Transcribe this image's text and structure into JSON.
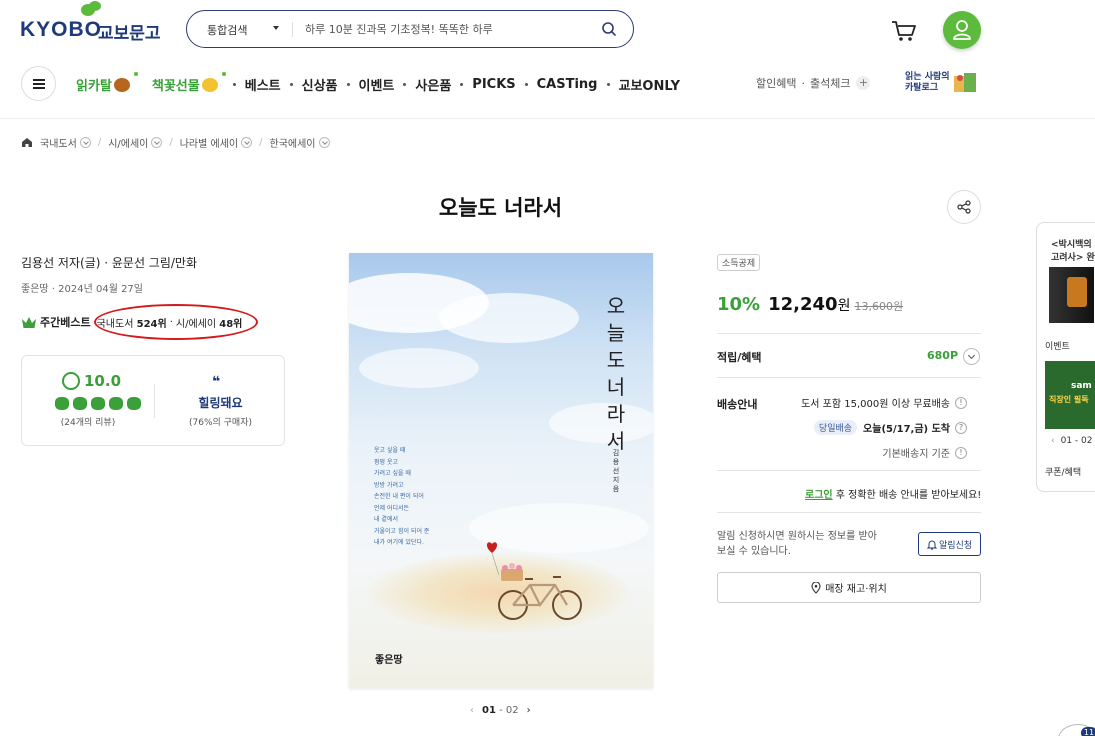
{
  "header": {
    "logo_en": "KYOBO",
    "logo_ko": "교보문고",
    "search_scope": "통합검색",
    "search_placeholder": "하루 10분 진과목 기초정복! 똑똑한 하루"
  },
  "nav": {
    "items": [
      {
        "label": "읽카탈",
        "green": true
      },
      {
        "label": "책꽃선물",
        "green": true
      },
      {
        "label": "베스트"
      },
      {
        "label": "신상품"
      },
      {
        "label": "이벤트"
      },
      {
        "label": "사은품"
      },
      {
        "label": "PICKS"
      },
      {
        "label": "CASTing"
      },
      {
        "label": "교보ONLY"
      }
    ],
    "right": {
      "benefit": "할인혜택",
      "attendance": "출석체크",
      "readers_line1": "읽는 사람의",
      "readers_line2": "카탈로그"
    }
  },
  "breadcrumb": [
    "국내도서",
    "시/에세이",
    "나라별 에세이",
    "한국에세이"
  ],
  "book": {
    "title": "오늘도 너라서",
    "author_line": "김용선 저자(글) · 윤문선 그림/만화",
    "publisher_line": "좋은땅 · 2024년 04월 27일",
    "bestseller_label": "주간베스트",
    "rank_domestic_label": "국내도서",
    "rank_domestic": "524위",
    "rank_sep": "·",
    "rank_cat_label": "시/에세이",
    "rank_cat": "48위"
  },
  "rating": {
    "score": "10.0",
    "reviews": "(24개의 리뷰)",
    "emotion": "힐링돼요",
    "emotion_pct": "(76%의 구매자)",
    "quote_mark": "❝"
  },
  "cover": {
    "title_chars": [
      "오",
      "늘",
      "도",
      "너",
      "라",
      "서"
    ],
    "author_vertical": [
      "김",
      "용",
      "선",
      "지",
      "음"
    ],
    "poem": "웃고 싶을 때\n펑펑 웃고\n가려고 싶을 때\n방방 가려고\n손전한 내 편이 되어\n언제 어디서든\n내 곁에서\n거울이고 힘이 되어 준\n내가 여기에 있단다.",
    "publisher": "좋은땅",
    "pager_current": "01",
    "pager_sep": "-",
    "pager_total": "02"
  },
  "purchase": {
    "tag": "소득공제",
    "discount": "10%",
    "price": "12,240",
    "won": "원",
    "original": "13,600원",
    "points_label": "적립/혜택",
    "points": "680P",
    "shipping_label": "배송안내",
    "shipping_free": "도서 포함 15,000원 이상 무료배송",
    "sameday": "당일배송",
    "arrival": "오늘(5/17,금) 도착",
    "basis": "기본배송지 기준",
    "login_link": "로그인",
    "login_rest": " 후 정확한 배송 안내를 받아보세요!",
    "alarm_text": "알림 신청하시면 원하시는 정보를 받아 보실 수 있습니다.",
    "alarm_btn": "알림신청",
    "store_btn": "매장 재고·위치"
  },
  "side": {
    "title1": "<박시백의",
    "title2": "고려사> 완",
    "event": "이벤트",
    "ad_name": "sam",
    "ad_text": "직장인 필독",
    "pager": "01 - 02",
    "coupon": "쿠폰/혜택",
    "badge": "11"
  }
}
